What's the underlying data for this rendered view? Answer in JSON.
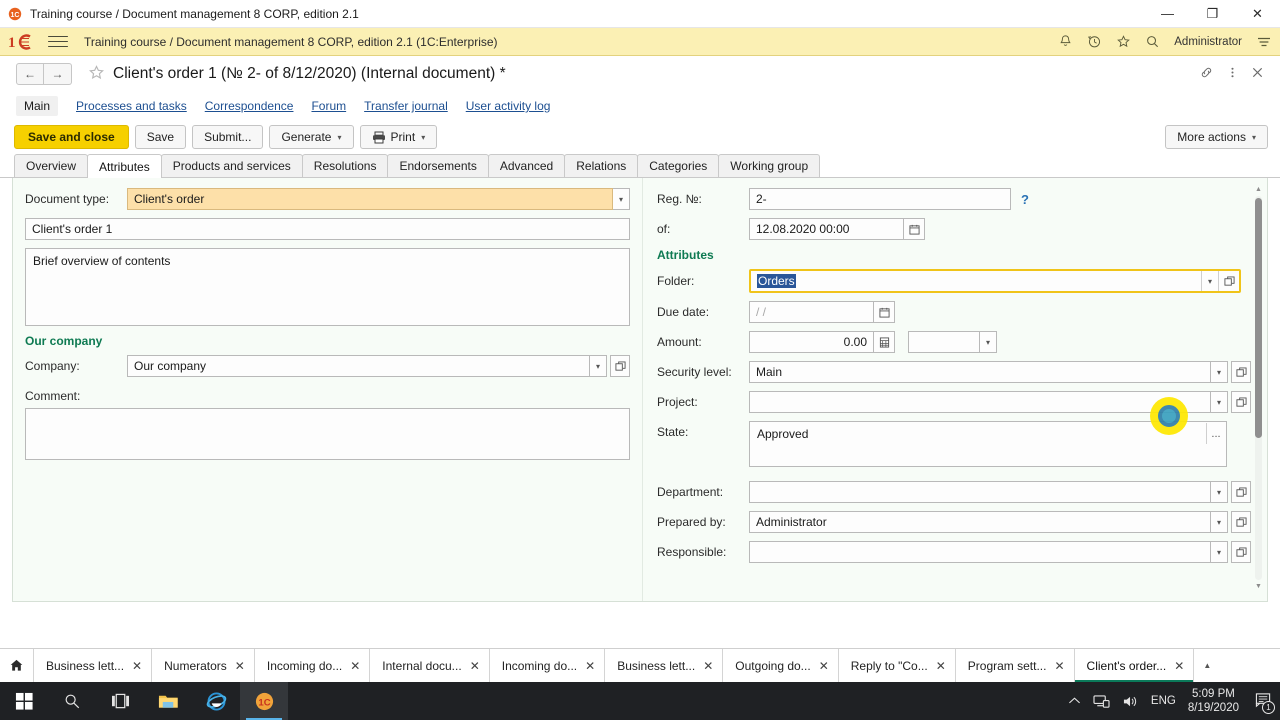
{
  "os_window": {
    "title": "Training course / Document management 8 CORP, edition 2.1",
    "icon": "1c-logo-icon",
    "minimize_label": "—",
    "maximize_label": "❐",
    "close_label": "✕"
  },
  "appbar": {
    "logo": "1C",
    "title": "Training course / Document management 8 CORP, edition 2.1  (1C:Enterprise)",
    "user": "Administrator",
    "icons": [
      "notifications-bell-icon",
      "history-clock-icon",
      "favorites-star-icon",
      "search-icon",
      "main-menu-icon"
    ]
  },
  "document_header": {
    "back_label": "←",
    "forward_label": "→",
    "favorite_icon": "star-outline-icon",
    "title": "Client's order 1 (№ 2- of 8/12/2020) (Internal document) *",
    "right_icons": [
      "link-icon",
      "more-vertical-icon",
      "close-icon"
    ]
  },
  "nav_links": [
    {
      "label": "Main",
      "active": true
    },
    {
      "label": "Processes and tasks",
      "active": false
    },
    {
      "label": "Correspondence",
      "active": false
    },
    {
      "label": "Forum",
      "active": false
    },
    {
      "label": "Transfer journal",
      "active": false
    },
    {
      "label": "User activity log",
      "active": false
    }
  ],
  "command_bar": {
    "save_and_close": "Save and close",
    "save": "Save",
    "submit": "Submit...",
    "generate": "Generate",
    "print": "Print",
    "more_actions": "More actions",
    "caret": "▾"
  },
  "tabs": [
    {
      "label": "Overview",
      "active": false
    },
    {
      "label": "Attributes",
      "active": true
    },
    {
      "label": "Products and services",
      "active": false
    },
    {
      "label": "Resolutions",
      "active": false
    },
    {
      "label": "Endorsements",
      "active": false
    },
    {
      "label": "Advanced",
      "active": false
    },
    {
      "label": "Relations",
      "active": false
    },
    {
      "label": "Categories",
      "active": false
    },
    {
      "label": "Working group",
      "active": false
    }
  ],
  "form_left": {
    "document_type_label": "Document type:",
    "document_type_value": "Client's order",
    "name_value": "Client's order 1",
    "overview_placeholder": "Brief overview of contents",
    "overview_value": "",
    "our_company_section": "Our company",
    "company_label": "Company:",
    "company_value": "Our company",
    "comment_label": "Comment:",
    "comment_value": ""
  },
  "form_right": {
    "reg_no_label": "Reg. №:",
    "reg_no_value": "2-",
    "help_icon": "?",
    "of_label": "of:",
    "of_value": "12.08.2020 00:00",
    "attributes_section": "Attributes",
    "folder_label": "Folder:",
    "folder_value": "Orders",
    "due_date_label": "Due date:",
    "due_date_value": "/  /",
    "amount_label": "Amount:",
    "amount_value": "0.00",
    "currency_value": "",
    "security_level_label": "Security level:",
    "security_level_value": "Main",
    "project_label": "Project:",
    "project_value": "",
    "state_label": "State:",
    "state_value": "Approved",
    "state_more_label": "...",
    "department_label": "Department:",
    "department_value": "",
    "prepared_by_label": "Prepared by:",
    "prepared_by_value": "Administrator",
    "responsible_label": "Responsible:",
    "responsible_value": ""
  },
  "open_windows": {
    "home_icon": "home-icon",
    "close_glyph": "✕",
    "more_glyph": "▲",
    "items": [
      {
        "label": "Business lett...",
        "active": false
      },
      {
        "label": "Numerators",
        "active": false
      },
      {
        "label": "Incoming do...",
        "active": false
      },
      {
        "label": "Internal docu...",
        "active": false
      },
      {
        "label": "Incoming do...",
        "active": false
      },
      {
        "label": "Business lett...",
        "active": false
      },
      {
        "label": "Outgoing do...",
        "active": false
      },
      {
        "label": "Reply to \"Co...",
        "active": false
      },
      {
        "label": "Program sett...",
        "active": false
      },
      {
        "label": "Client's order...",
        "active": true
      }
    ]
  },
  "taskbar": {
    "items": [
      "windows-start-icon",
      "search-icon",
      "task-view-icon",
      "file-explorer-icon",
      "internet-explorer-icon",
      "1c-enterprise-icon"
    ],
    "tray_expand_icon": "chevron-up-icon",
    "network_icon": "network-icon",
    "volume_icon": "volume-icon",
    "language": "ENG",
    "time": "5:09 PM",
    "date": "8/19/2020",
    "notifications_icon": "action-center-icon",
    "notifications_count": "1"
  },
  "colors": {
    "accent_yellow": "#f6d000",
    "appbar_yellow": "#fbf0b4",
    "highlight_field": "#fde0a9",
    "section_green": "#0e7a52",
    "selection_blue": "#2a5699",
    "focus_border": "#f0c419",
    "click_highlight": "#ffe800",
    "form_background": "#f7fcf7"
  }
}
